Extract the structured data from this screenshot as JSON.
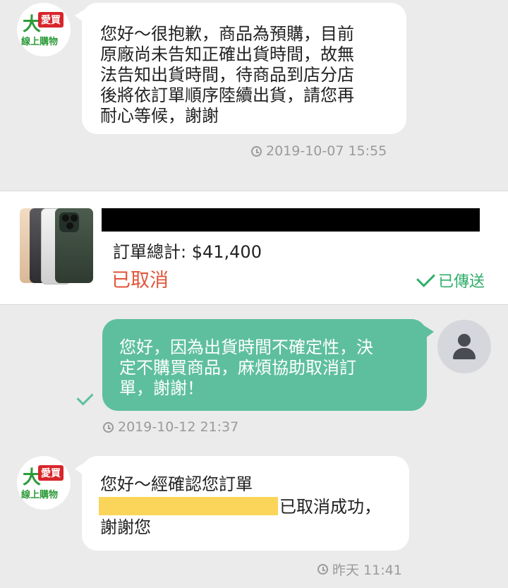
{
  "messages": [
    {
      "sender": "shop",
      "text": "您好～很抱歉，商品為預購，目前\n原廠尚未告知正確出貨時間，故無\n法告知出貨時間，待商品到店分店\n後將依訂單順序陸續出貨，請您再\n耐心等候，謝謝",
      "time": "2019-10-07 15:55"
    },
    {
      "sender": "user",
      "text": "您好，因為出貨時間不確定性，決\n定不購買商品，麻煩協助取消訂\n單，謝謝！",
      "time": "2019-10-12 21:37"
    },
    {
      "sender": "shop",
      "text_line1": "您好～經確認您訂單",
      "text_line2_suffix": "已取消成功，",
      "text_line3": "謝謝您",
      "time": "昨天 11:41"
    }
  ],
  "shop_avatar": {
    "logo_big": "大",
    "logo_tag": "愛買",
    "logo_sub": "線上購物"
  },
  "order_card": {
    "total": "訂單總計: $41,400",
    "status": "已取消",
    "sent_label": "已傳送",
    "status_color": "#e0553a",
    "sent_color": "#2fae6a"
  },
  "colors": {
    "background": "#ebebeb",
    "incoming_bubble": "#ffffff",
    "outgoing_bubble": "#5ebf9f",
    "timestamp": "#9a9a9a",
    "highlight": "#fbd45a"
  },
  "icons": [
    "clock-icon",
    "checkmark-icon",
    "user-avatar-icon",
    "shop-logo"
  ]
}
